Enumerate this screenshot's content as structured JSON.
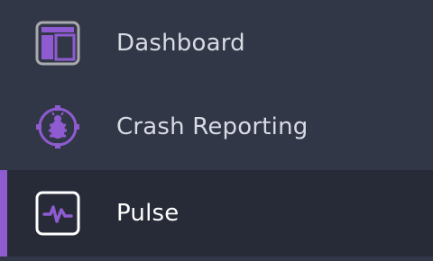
{
  "sidebar": {
    "items": [
      {
        "label": "Dashboard",
        "icon": "dashboard-icon",
        "active": false
      },
      {
        "label": "Crash Reporting",
        "icon": "bug-icon",
        "active": true
      },
      {
        "label": "Pulse",
        "icon": "pulse-icon",
        "active": true
      }
    ]
  },
  "colors": {
    "background": "#323747",
    "active_background": "#272b38",
    "accent": "#8e5bd1",
    "icon_frame": "#a9a9b0",
    "label": "#d8dbe4",
    "active_label": "#ffffff"
  }
}
